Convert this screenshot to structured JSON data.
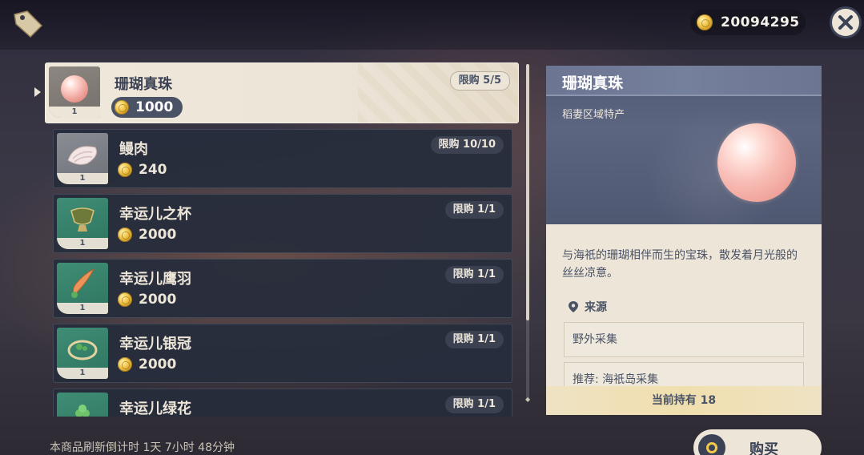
{
  "currency": {
    "amount": "20094295"
  },
  "shop": {
    "refresh_text": "本商品刷新倒计时 1天 7小时 48分钟",
    "buy_label": "购买",
    "items": [
      {
        "name": "珊瑚真珠",
        "price": "1000",
        "limit": "限购 5/5",
        "count": "1",
        "icon": "coral-pearl-icon",
        "selected": true
      },
      {
        "name": "鳗肉",
        "price": "240",
        "limit": "限购 10/10",
        "count": "1",
        "icon": "eel-meat-icon"
      },
      {
        "name": "幸运儿之杯",
        "price": "2000",
        "limit": "限购 1/1",
        "count": "1",
        "icon": "lucky-cup-icon"
      },
      {
        "name": "幸运儿鹰羽",
        "price": "2000",
        "limit": "限购 1/1",
        "count": "1",
        "icon": "eagle-feather-icon"
      },
      {
        "name": "幸运儿银冠",
        "price": "2000",
        "limit": "限购 1/1",
        "count": "1",
        "icon": "silver-circlet-icon"
      },
      {
        "name": "幸运儿绿花",
        "price": "",
        "limit": "限购 1/1",
        "count": "",
        "icon": "green-flower-icon"
      }
    ]
  },
  "detail": {
    "title": "珊瑚真珠",
    "subtitle": "稻妻区域特产",
    "description": "与海祇的珊瑚相伴而生的宝珠，散发着月光般的丝丝凉意。",
    "source_label": "来源",
    "sources": [
      "野外采集",
      "推荐: 海祇岛采集"
    ],
    "owned": "当前持有 18"
  }
}
